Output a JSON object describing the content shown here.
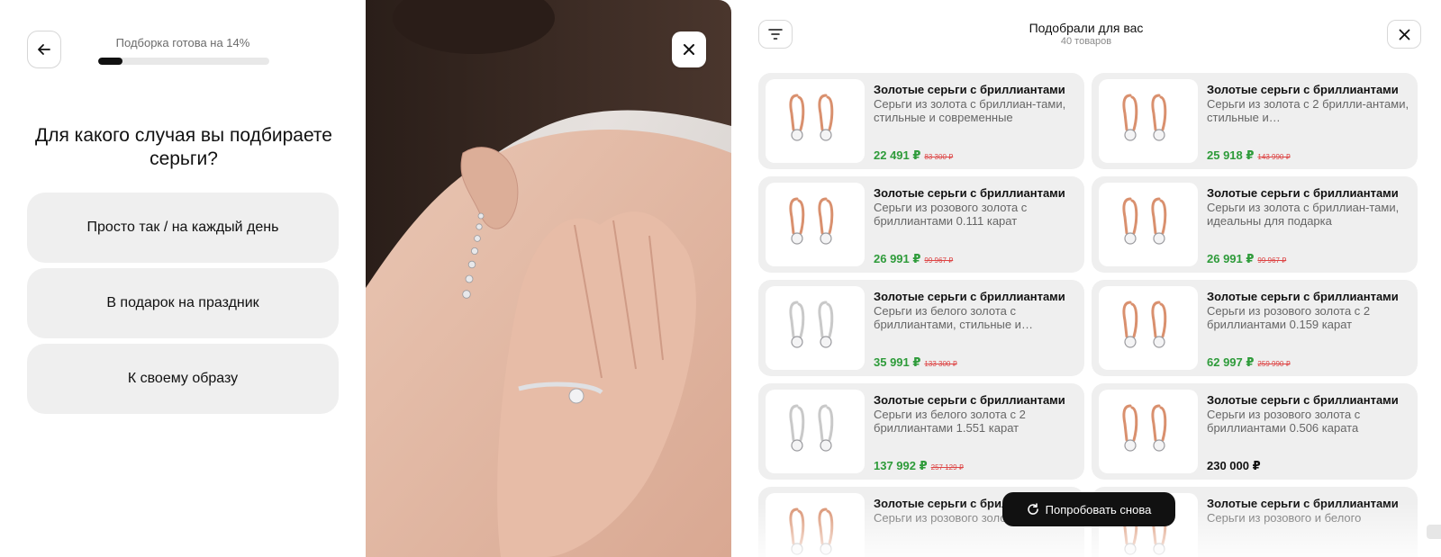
{
  "quiz": {
    "progress_label": "Подборка готова на 14%",
    "progress_value": 0.14,
    "question": "Для какого случая вы подбираете серьги?",
    "options": [
      {
        "label": "Просто так / на каждый день"
      },
      {
        "label": "В подарок на праздник"
      },
      {
        "label": "К своему образу"
      }
    ]
  },
  "results": {
    "title": "Подобрали для вас",
    "count": "40 товаров",
    "retry_label": "Попробовать снова",
    "products": [
      {
        "name": "Золотые серьги с бриллиантами",
        "desc": "Серьги из золота с бриллиан-тами, стильные и современные",
        "price": "22 491 ₽",
        "old_price": "83 300 ₽",
        "metal": "rose"
      },
      {
        "name": "Золотые серьги с бриллиантами",
        "desc": "Серьги из золота с 2 брилли-антами, стильные и…",
        "price": "25 918 ₽",
        "old_price": "143 990 ₽",
        "metal": "rose"
      },
      {
        "name": "Золотые серьги с бриллиантами",
        "desc": "Серьги из розового золота с бриллиантами 0.111 карат",
        "price": "26 991 ₽",
        "old_price": "99 967 ₽",
        "metal": "rose"
      },
      {
        "name": "Золотые серьги с бриллиантами",
        "desc": "Серьги из золота с бриллиан-тами, идеальны для подарка",
        "price": "26 991 ₽",
        "old_price": "99 967 ₽",
        "metal": "rose"
      },
      {
        "name": "Золотые серьги с бриллиантами",
        "desc": "Серьги из белого золота с бриллиантами, стильные и…",
        "price": "35 991 ₽",
        "old_price": "133 300 ₽",
        "metal": "white"
      },
      {
        "name": "Золотые серьги с бриллиантами",
        "desc": "Серьги из розового золота с 2 бриллиантами 0.159 карат",
        "price": "62 997 ₽",
        "old_price": "259 990 ₽",
        "metal": "rose"
      },
      {
        "name": "Золотые серьги с бриллиантами",
        "desc": "Серьги из белого золота с 2 бриллиантами 1.551 карат",
        "price": "137 992 ₽",
        "old_price": "257 129 ₽",
        "metal": "white"
      },
      {
        "name": "Золотые серьги с бриллиантами",
        "desc": "Серьги из розового золота с бриллиантами 0.506 карата",
        "price": "230 000 ₽",
        "old_price": "",
        "metal": "rose"
      },
      {
        "name": "Золотые серьги с бриллиантами",
        "desc": "Серьги из розового золота с",
        "price": "",
        "old_price": "",
        "metal": "rose"
      },
      {
        "name": "Золотые серьги с бриллиантами",
        "desc": "Серьги из розового и белого",
        "price": "",
        "old_price": "",
        "metal": "rose"
      }
    ]
  },
  "colors": {
    "accent": "#111111",
    "price_green": "#2e9b3a",
    "old_price_red": "#dd4444",
    "card_bg": "#efefef",
    "rose_gold": "#d9906e",
    "white_gold": "#c9c9c9"
  }
}
